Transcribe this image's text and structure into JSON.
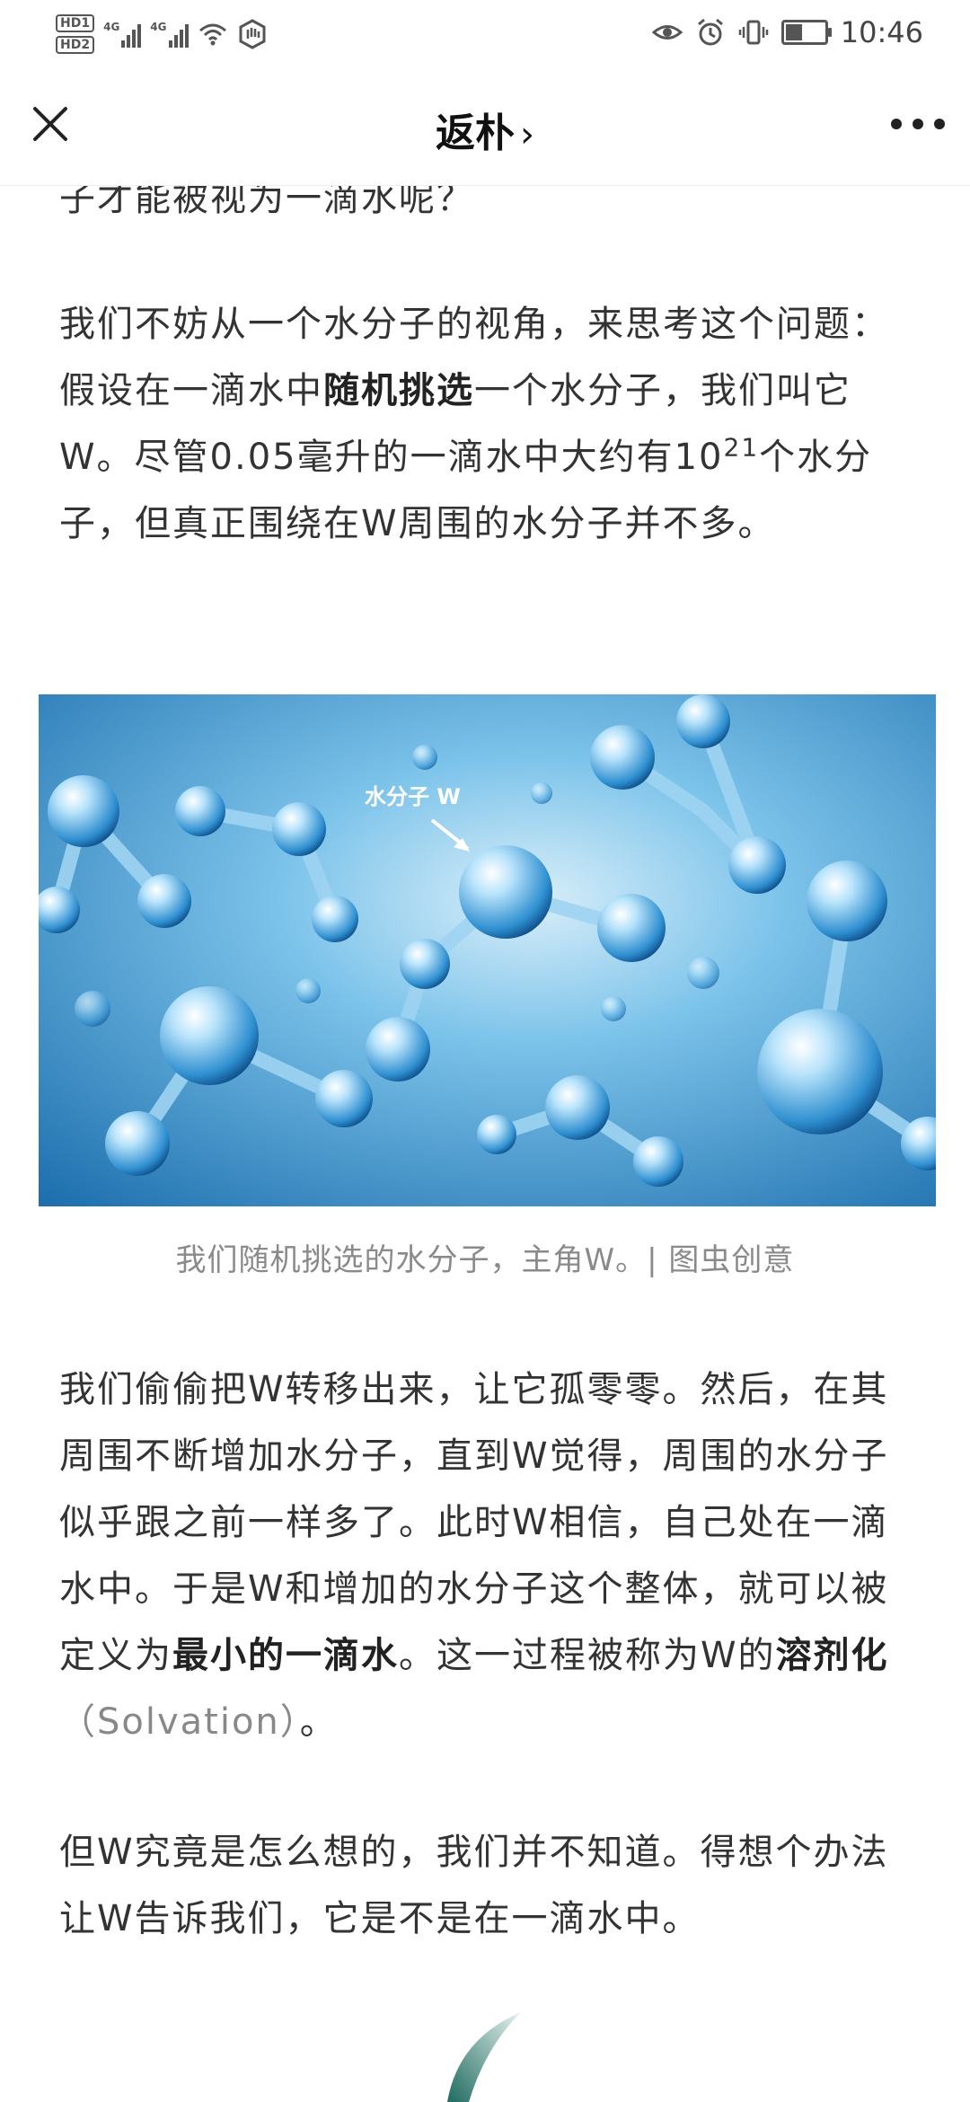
{
  "status_bar": {
    "network": "4G",
    "time": "10:46",
    "hd1": "HD1",
    "hd2": "HD2"
  },
  "nav": {
    "title": "返朴",
    "chevron": "›"
  },
  "article": {
    "partial_top": "子才能被视为一滴水呢？",
    "p1": {
      "a": "我们不妨从一个水分子的视角，来思考这个问题：假设在一滴水中",
      "b_bold": "随机挑选",
      "c": "一个水分子，我们叫它W。尽管0.05毫升的一滴水中大约有10",
      "sup": "21",
      "d": "个水分子，但真正围绕在W周围的水分子并不多。"
    },
    "figure_label": "水分子 W",
    "caption": "我们随机挑选的水分子，主角W。| 图虫创意",
    "p2": {
      "a": "我们偷偷把W转移出来，让它孤零零。然后，在其周围不断增加水分子，直到W觉得，周围的水分子似乎跟之前一样多了。此时W相信，自己处在一滴水中。于是W和增加的水分子这个整体，就可以被定义为",
      "b_bold": "最小的一滴水",
      "c": "。这一过程被称为W的",
      "d_bold": "溶剂化",
      "e_light": "（Solvation）",
      "f": "。"
    },
    "p3": "但W究竟是怎么想的，我们并不知道。得想个办法让W告诉我们，它是不是在一滴水中。"
  },
  "colors": {
    "figure_bg": "#4fa7dc",
    "molecule": "#a9dcf7"
  }
}
